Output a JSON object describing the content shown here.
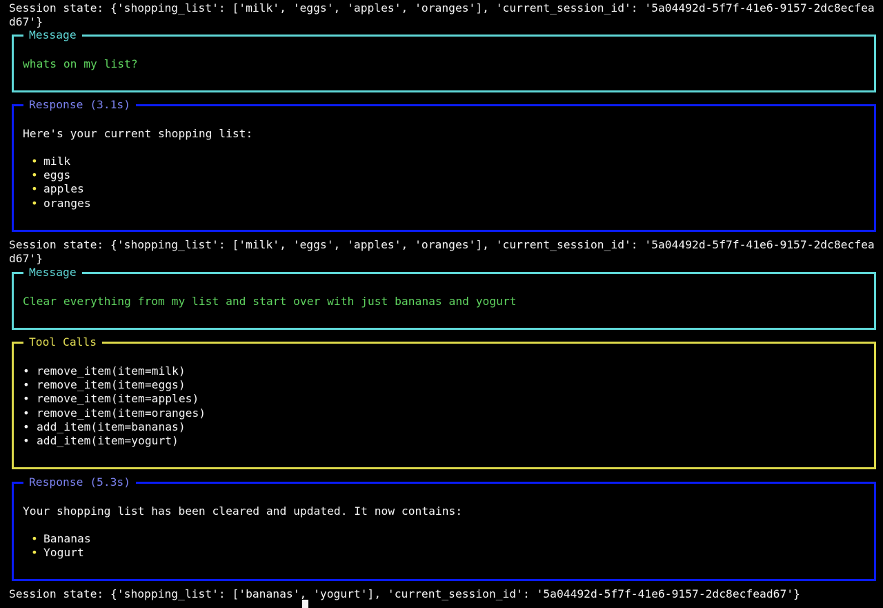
{
  "colors": {
    "message_border": "#5fd7d7",
    "message_text": "#5fd35f",
    "response_border": "#0a1cf5",
    "response_title": "#7b82f0",
    "toolcalls_border": "#dcd84a",
    "bullet": "#f2e94e",
    "background": "#000000",
    "text": "#f4f4f4"
  },
  "session_states": [
    {
      "line1": "Session state: {'shopping_list': ['milk', 'eggs', 'apples', 'oranges'], 'current_session_id': '5a04492d-5f7f-41e6-9157-2dc8ecfea",
      "line2": "d67'}"
    },
    {
      "line1": "Session state: {'shopping_list': ['milk', 'eggs', 'apples', 'oranges'], 'current_session_id': '5a04492d-5f7f-41e6-9157-2dc8ecfea",
      "line2": "d67'}"
    },
    {
      "line1": "Session state: {'shopping_list': ['bananas', 'yogurt'], 'current_session_id': '5a04492d-5f7f-41e6-9157-2dc8ecfead67'}"
    }
  ],
  "panels": {
    "message1": {
      "title": "Message",
      "text": "whats on my list?"
    },
    "response1": {
      "title": "Response (3.1s)",
      "intro": "Here's your current shopping list:",
      "items": [
        "milk",
        "eggs",
        "apples",
        "oranges"
      ]
    },
    "message2": {
      "title": "Message",
      "text": "Clear everything from my list and start over with just bananas and yogurt"
    },
    "toolcalls": {
      "title": "Tool Calls",
      "items": [
        "remove_item(item=milk)",
        "remove_item(item=eggs)",
        "remove_item(item=apples)",
        "remove_item(item=oranges)",
        "add_item(item=bananas)",
        "add_item(item=yogurt)"
      ]
    },
    "response2": {
      "title": "Response (5.3s)",
      "intro": "Your shopping list has been cleared and updated. It now contains:",
      "items": [
        "Bananas",
        "Yogurt"
      ]
    }
  },
  "bullet_glyph": "•"
}
